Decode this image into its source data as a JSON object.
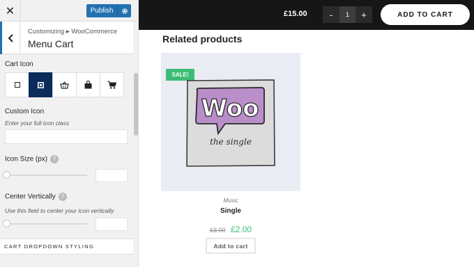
{
  "customizer": {
    "publish_label": "Publish",
    "breadcrumb": "Customizing ▸ WooCommerce",
    "section_title": "Menu Cart",
    "cart_icon": {
      "label": "Cart Icon",
      "options": [
        "square-outline-icon",
        "square-filled-icon",
        "basket-icon",
        "bag-icon",
        "cart-icon"
      ],
      "selected_index": 1
    },
    "custom_icon": {
      "label": "Custom Icon",
      "description": "Enter your full icon class",
      "value": ""
    },
    "icon_size": {
      "label": "Icon Size (px)",
      "value": ""
    },
    "center_vertically": {
      "label": "Center Vertically",
      "description": "Use this field to center your icon vertically",
      "value": ""
    },
    "dropdown_section": "CART DROPDOWN STYLING"
  },
  "preview": {
    "cart_total": "£15.00",
    "quantity": "1",
    "minus": "-",
    "plus": "+",
    "add_to_cart": "ADD TO CART",
    "related_title": "Related products",
    "product": {
      "badge": "SALE!",
      "category": "Music",
      "name": "Single",
      "old_price": "£3.00",
      "new_price": "£2.00",
      "button": "Add to cart",
      "image_text": "Woo",
      "image_subtext": "the single"
    }
  },
  "colors": {
    "accent": "#2271b1",
    "selected_icon": "#0a2c5a",
    "sale": "#3cbd75",
    "preview_bar": "#161616"
  }
}
